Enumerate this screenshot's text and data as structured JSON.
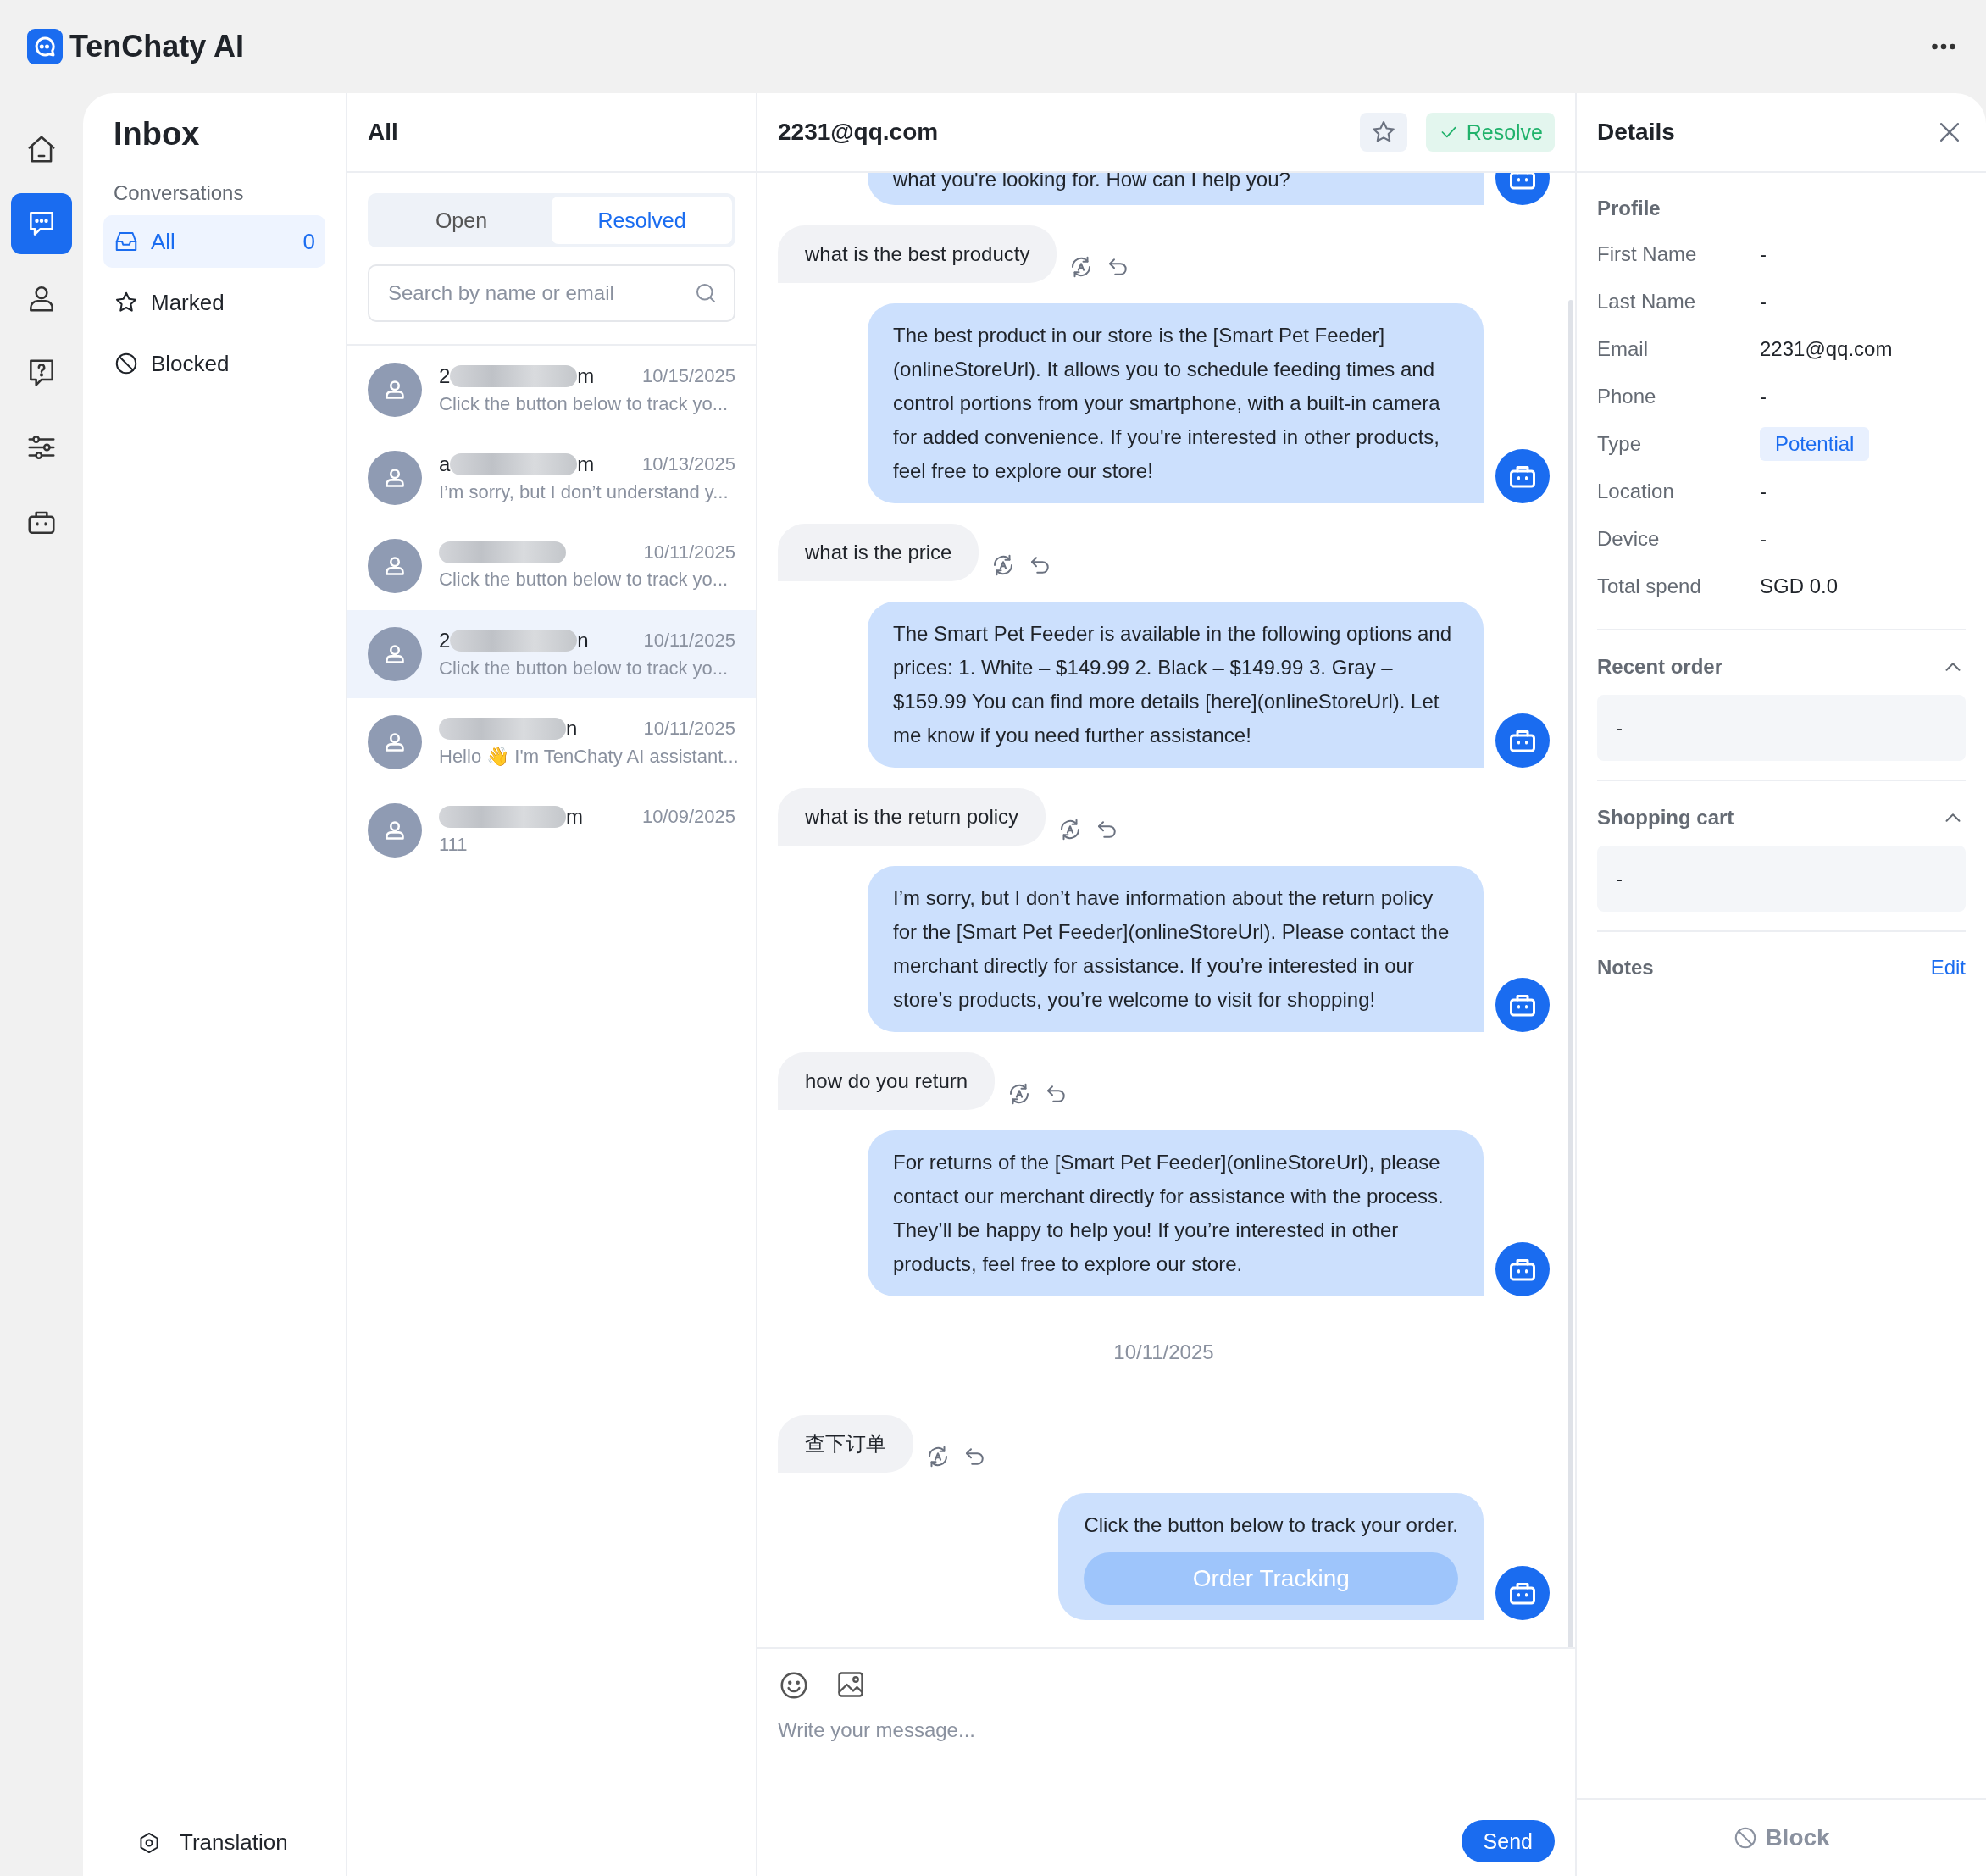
{
  "app": {
    "title": "TenChaty AI"
  },
  "rail": [
    {
      "selected": false
    },
    {
      "selected": true
    },
    {
      "selected": false
    },
    {
      "selected": false
    },
    {
      "selected": false
    },
    {
      "selected": false
    }
  ],
  "inbox": {
    "title": "Inbox",
    "section": "Conversations",
    "items": [
      {
        "label": "All",
        "count": "0",
        "selected": true
      },
      {
        "label": "Marked",
        "selected": false
      },
      {
        "label": "Blocked",
        "selected": false
      }
    ],
    "footer": "Translation"
  },
  "list": {
    "title": "All",
    "tabs": [
      {
        "label": "Open",
        "selected": false
      },
      {
        "label": "Resolved",
        "selected": true
      }
    ],
    "search": {
      "placeholder": "Search by name or email"
    },
    "rows": [
      {
        "name_start": "2",
        "name_end": "m",
        "date": "10/15/2025",
        "preview": "Click the button below to track yo...",
        "selected": false
      },
      {
        "name_start": "a",
        "name_end": "m",
        "date": "10/13/2025",
        "preview": "I’m sorry, but I don’t understand y...",
        "selected": false
      },
      {
        "date": "10/11/2025",
        "preview": "Click the button below to track yo...",
        "selected": false
      },
      {
        "name_start": "2",
        "name_end": "n",
        "date": "10/11/2025",
        "preview": "Click the button below to track yo...",
        "selected": true
      },
      {
        "name_end": "n",
        "date": "10/11/2025",
        "preview": "Hello 👋 I'm TenChaty AI assistant...",
        "selected": false
      },
      {
        "name_end": "m",
        "date": "10/09/2025",
        "preview": "111",
        "selected": false
      }
    ]
  },
  "chat": {
    "title": "2231@qq.com",
    "marked": false,
    "resolve": "Resolve",
    "messages": [
      {
        "kind": "bot_cut",
        "text": "what you're looking for. How can I help you?"
      },
      {
        "kind": "user",
        "text": "what is the best producty"
      },
      {
        "kind": "bot",
        "text": "The best product in our store is the [Smart Pet Feeder](onlineStoreUrl). It allows you to schedule feeding times and control portions from your smartphone, with a built-in camera for added convenience. If you're interested in other products, feel free to explore our store!"
      },
      {
        "kind": "user",
        "text": "what is the price"
      },
      {
        "kind": "bot",
        "text": "The Smart Pet Feeder is available in the following options and prices: 1. White – $149.99 2. Black – $149.99 3. Gray – $159.99 You can find more details [here](onlineStoreUrl). Let me know if you need further assistance!"
      },
      {
        "kind": "user",
        "text": "what is the return policy"
      },
      {
        "kind": "bot",
        "text": "I’m sorry, but I don’t have information about the return policy for the [Smart Pet Feeder](onlineStoreUrl). Please contact the merchant directly for assistance. If you’re interested in our store’s products, you’re welcome to visit for shopping!"
      },
      {
        "kind": "user",
        "text": "how do you return"
      },
      {
        "kind": "bot",
        "text": "For returns of the [Smart Pet Feeder](onlineStoreUrl), please contact our merchant directly for assistance with the process. They’ll be happy to help you! If you’re interested in other products, feel free to explore our store."
      },
      {
        "kind": "date",
        "text": "10/11/2025"
      },
      {
        "kind": "user",
        "text": "查下订单"
      },
      {
        "kind": "bot",
        "text": "Click the button below to track your order.",
        "button": "Order Tracking"
      }
    ],
    "composer": {
      "placeholder": "Write your message...",
      "send": "Send"
    }
  },
  "details": {
    "title": "Details",
    "profile_title": "Profile",
    "fields": [
      {
        "label": "First Name",
        "value": "-"
      },
      {
        "label": "Last Name",
        "value": "-"
      },
      {
        "label": "Email",
        "value": "2231@qq.com"
      },
      {
        "label": "Phone",
        "value": "-"
      },
      {
        "label": "Type",
        "value": "Potential",
        "kind": "tag"
      },
      {
        "label": "Location",
        "value": "-"
      },
      {
        "label": "Device",
        "value": "-"
      },
      {
        "label": "Total spend",
        "value": "SGD 0.0"
      }
    ],
    "sections": [
      {
        "title": "Recent order",
        "expanded": true,
        "value": "-"
      },
      {
        "title": "Shopping cart",
        "expanded": true,
        "value": "-"
      }
    ],
    "notes": {
      "title": "Notes",
      "action": "Edit"
    },
    "block": "Block"
  }
}
